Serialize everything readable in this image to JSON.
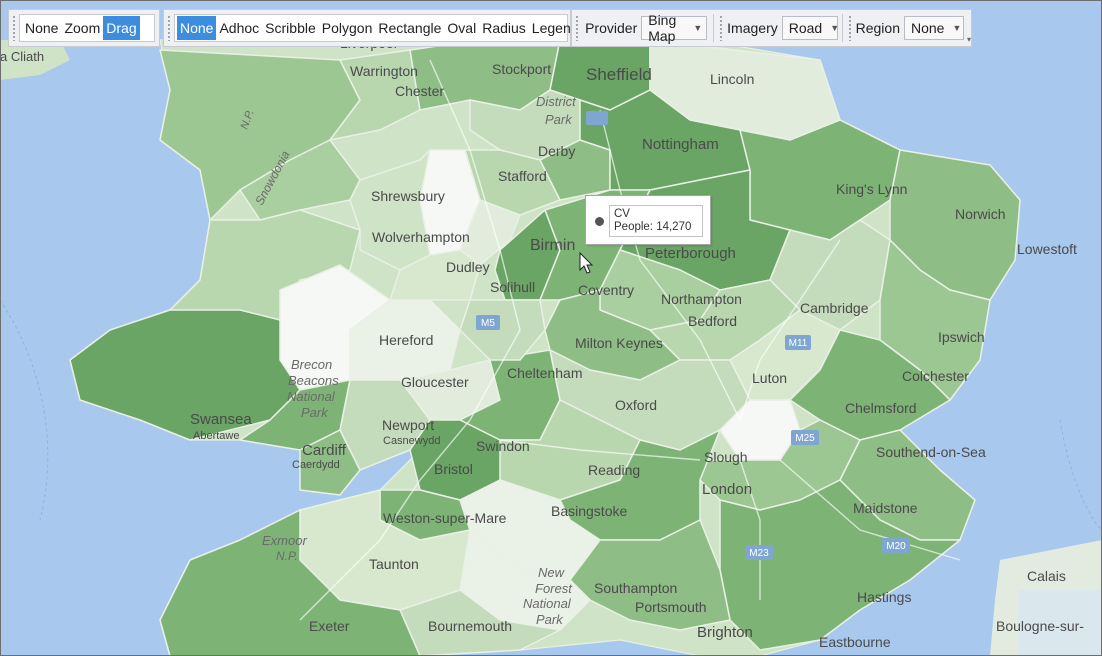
{
  "toolbar": {
    "mode_options": [
      "None",
      "Zoom",
      "Drag"
    ],
    "mode_selected": "Drag",
    "draw_options": [
      "None",
      "Adhoc",
      "Scribble",
      "Polygon",
      "Rectangle",
      "Oval",
      "Radius",
      "Legend"
    ],
    "draw_selected": "None",
    "provider_label": "Provider",
    "provider_value": "Bing Map",
    "imagery_label": "Imagery",
    "imagery_value": "Road",
    "region_label": "Region",
    "region_value": "None"
  },
  "colors": {
    "sea": "#a9c8ee",
    "land_base": "#cfe3c6",
    "selected_tab": "#3c8dde",
    "shade_darkest": "#6aa565",
    "shade_lightest": "#f6f8f5"
  },
  "tooltip": {
    "code": "CV",
    "metric_text": "People: 14,270"
  },
  "map_labels": {
    "baile_atha_cliath": "a Cliath",
    "liverpool": "Liverpool",
    "warrington": "Warrington",
    "stockport": "Stockport",
    "sheffield": "Sheffield",
    "chester": "Chester",
    "lincoln": "Lincoln",
    "district": "District",
    "park": "Park",
    "derby": "Derby",
    "nottingham": "Nottingham",
    "snowdonia": "Snowdonia",
    "np": "N.P.",
    "stafford": "Stafford",
    "shrewsbury": "Shrewsbury",
    "kings_lynn": "King's Lynn",
    "norwich": "Norwich",
    "wolverhampton": "Wolverhampton",
    "birmingham": "Birmin",
    "peterborough": "Peterborough",
    "lowestoft": "Lowestoft",
    "dudley": "Dudley",
    "solihull": "Solihull",
    "coventry": "Coventry",
    "northampton": "Northampton",
    "cambridge": "Cambridge",
    "hereford": "Hereford",
    "m5": "M5",
    "bedford": "Bedford",
    "ipswich": "Ipswich",
    "milton_keynes": "Milton Keynes",
    "m11": "M11",
    "brecon": "Brecon",
    "beacons": "Beacons",
    "national": "National",
    "park2": "Park",
    "gloucester": "Gloucester",
    "cheltenham": "Cheltenham",
    "luton": "Luton",
    "colchester": "Colchester",
    "swansea": "Swansea",
    "abertawe": "Abertawe",
    "oxford": "Oxford",
    "chelmsford": "Chelmsford",
    "newport": "Newport",
    "casnewydd": "Casnewydd",
    "m25": "M25",
    "cardiff": "Cardiff",
    "caerdydd": "Caerdydd",
    "swindon": "Swindon",
    "slough": "Slough",
    "southend": "Southend-on-Sea",
    "bristol": "Bristol",
    "reading": "Reading",
    "london": "London",
    "weston": "Weston-super-Mare",
    "basingstoke": "Basingstoke",
    "maidstone": "Maidstone",
    "exmoor": "Exmoor",
    "np2": "N.P.",
    "m23": "M23",
    "m20": "M20",
    "taunton": "Taunton",
    "new_forest": "New",
    "forest": "Forest",
    "national2": "National",
    "park3": "Park",
    "calais": "Calais",
    "southampton": "Southampton",
    "hastings": "Hastings",
    "portsmouth": "Portsmouth",
    "bournemouth": "Bournemouth",
    "exeter": "Exeter",
    "brighton": "Brighton",
    "eastbourne": "Eastbourne",
    "boulogne": "Boulogne-sur-"
  }
}
